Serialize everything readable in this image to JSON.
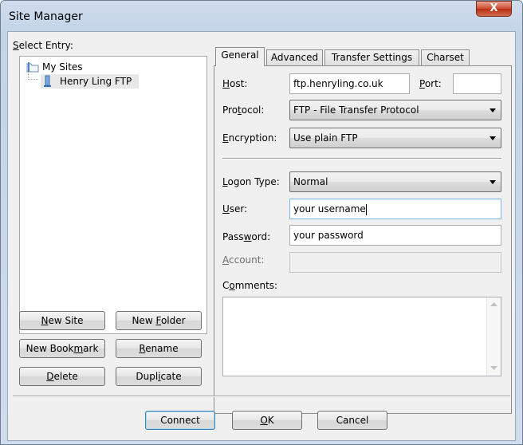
{
  "window": {
    "title": "Site Manager",
    "close_glyph": "X"
  },
  "select_entry": {
    "pre": "",
    "u": "S",
    "post": "elect Entry:"
  },
  "tree": {
    "root": {
      "label": "My Sites",
      "icon": "folder-icon"
    },
    "child": {
      "label": "Henry Ling FTP",
      "icon": "server-icon"
    }
  },
  "left_buttons": {
    "new_site": {
      "pre": "",
      "u": "N",
      "post": "ew Site"
    },
    "new_folder": {
      "pre": "New ",
      "u": "F",
      "post": "older"
    },
    "new_bookmark": {
      "pre": "New Book",
      "u": "m",
      "post": "ark"
    },
    "rename": {
      "pre": "",
      "u": "R",
      "post": "ename"
    },
    "delete": {
      "pre": "",
      "u": "D",
      "post": "elete"
    },
    "duplicate": {
      "pre": "Dupl",
      "u": "i",
      "post": "cate"
    }
  },
  "tabs": [
    "General",
    "Advanced",
    "Transfer Settings",
    "Charset"
  ],
  "general": {
    "host": {
      "pre": "",
      "u": "H",
      "post": "ost:",
      "value": "ftp.henryling.co.uk"
    },
    "port": {
      "pre": "",
      "u": "P",
      "post": "ort:",
      "value": ""
    },
    "protocol": {
      "pre": "Pro",
      "u": "t",
      "post": "ocol:",
      "value": "FTP - File Transfer Protocol"
    },
    "encryption": {
      "pre": "",
      "u": "E",
      "post": "ncryption:",
      "value": "Use plain FTP"
    },
    "logon_type": {
      "pre": "",
      "u": "L",
      "post": "ogon Type:",
      "value": "Normal"
    },
    "user": {
      "pre": "",
      "u": "U",
      "post": "ser:",
      "value": "your username"
    },
    "password": {
      "pre": "Pass",
      "u": "w",
      "post": "ord:",
      "value": "your password"
    },
    "account": {
      "pre": "",
      "u": "A",
      "post": "ccount:",
      "value": ""
    },
    "comments": {
      "pre": "C",
      "u": "o",
      "post": "mments:",
      "value": ""
    }
  },
  "bottom_buttons": {
    "connect": {
      "pre": "",
      "u": "",
      "post": "Connect"
    },
    "ok": {
      "pre": "",
      "u": "O",
      "post": "K"
    },
    "cancel": {
      "pre": "",
      "u": "",
      "post": "Cancel"
    }
  },
  "colors": {
    "accent": "#3c7fb1",
    "close": "#c7432a",
    "selection": "#e8e8e8"
  }
}
